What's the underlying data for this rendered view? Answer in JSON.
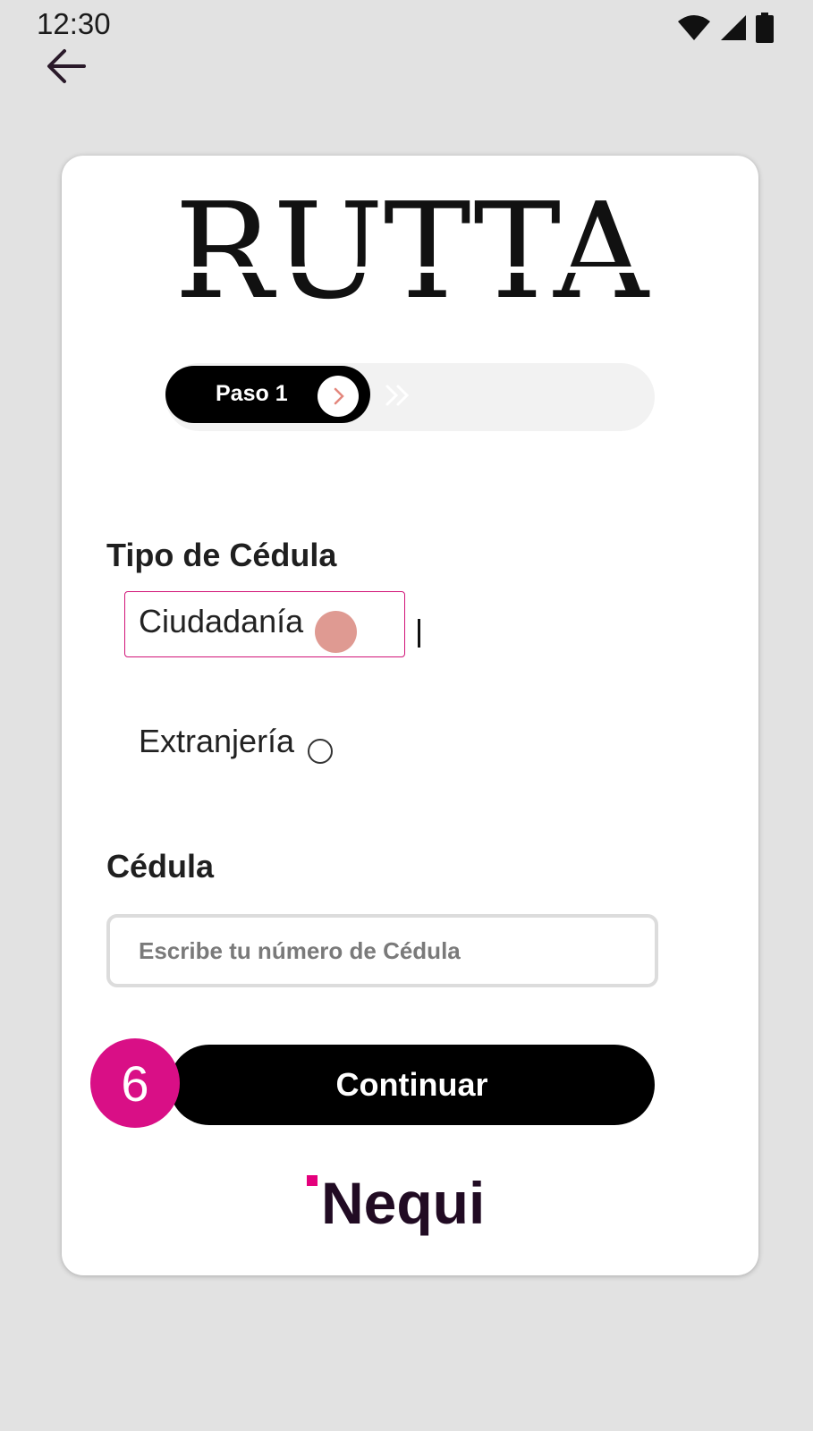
{
  "status_bar": {
    "time": "12:30",
    "icons": [
      "wifi-icon",
      "cell-signal-icon",
      "battery-icon"
    ]
  },
  "nav": {
    "back_icon": "arrow-left-icon"
  },
  "brand": {
    "logo_text": "RUTTA"
  },
  "stepper": {
    "current_label": "Paso 1",
    "arrow_icon": "chevron-right-icon",
    "next_icon": "double-chevron-right-icon"
  },
  "form": {
    "tipo_label": "Tipo de Cédula",
    "options": [
      {
        "label": "Ciudadanía",
        "selected": true
      },
      {
        "label": "Extranjería",
        "selected": false
      }
    ],
    "cedula_label": "Cédula",
    "cedula_value": "",
    "cedula_placeholder": "Escribe tu número de Cédula"
  },
  "actions": {
    "continue_label": "Continuar"
  },
  "annotation": {
    "step_number": "6"
  },
  "partner": {
    "logo_text": "Nequi"
  },
  "colors": {
    "background": "#e2e2e2",
    "card": "#ffffff",
    "accent_pink": "#d90f86",
    "selected_radio": "#df9a92",
    "primary_button": "#000000"
  }
}
